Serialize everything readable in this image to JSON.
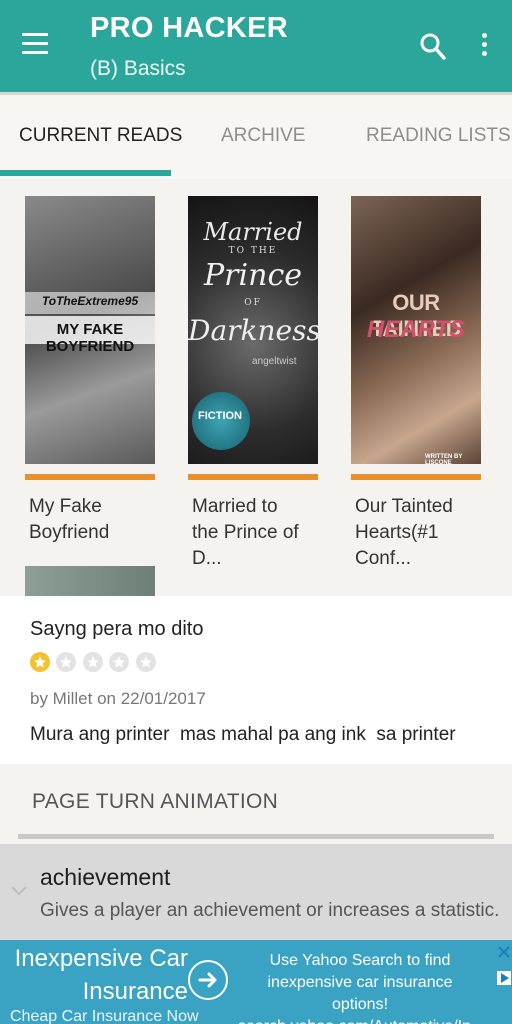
{
  "app_bar": {
    "title": "PRO HACKER",
    "subtitle": "(B) Basics",
    "menu_icon": "hamburger-menu-icon",
    "search_icon": "search-icon",
    "overflow_icon": "more-vert-icon",
    "color": "#2aa69a"
  },
  "tabs": {
    "items": [
      {
        "label": "CURRENT READS",
        "active": true
      },
      {
        "label": "ARCHIVE",
        "active": false
      },
      {
        "label": "READING LISTS",
        "active": false
      }
    ],
    "indicator_color": "#2aa69a"
  },
  "books": [
    {
      "title": "My Fake\nBoyfriend",
      "cover_author": "ToTheExtreme95",
      "cover_title": "MY FAKE BOYFRIEND"
    },
    {
      "title": "Married to\nthe Prince of D...",
      "cover_line1": "Married",
      "cover_line2": "Prince",
      "cover_small": "TO THE",
      "cover_of": "OF",
      "cover_line3": "Darkness",
      "cover_author": "angeltwist",
      "cover_badge": "FICTION"
    },
    {
      "title": "Our Tainted\nHearts(#1 Conf...",
      "cover_line1": "OUR TAINTED",
      "cover_line2": "HEARTS",
      "cover_author": "WRITTEN BY LISCONE"
    }
  ],
  "progress_color": "#e8912c",
  "review": {
    "title": "Sayng pera mo dito",
    "rating": 1,
    "rating_max": 5,
    "byline": "by Millet on 22/01/2017",
    "body": "Mura ang printer  mas mahal pa ang ink  sa printer"
  },
  "page_turn": {
    "title": "PAGE TURN ANIMATION"
  },
  "achievement": {
    "title": "achievement",
    "description": "Gives a player an achievement or increases a statistic.",
    "chevron_icon": "chevron-down-icon"
  },
  "ad": {
    "headline": "Inexpensive Car\nInsurance",
    "subline": "Cheap Car Insurance Now",
    "text": "Use Yahoo Search to find\ninexpensive car insurance options!\nsearch.yahoo.com/Automotive/In...",
    "arrow_icon": "arrow-right-circle-icon",
    "close_icon": "close-icon",
    "info_icon": "ad-choices-icon",
    "color": "#3aa3c4"
  }
}
